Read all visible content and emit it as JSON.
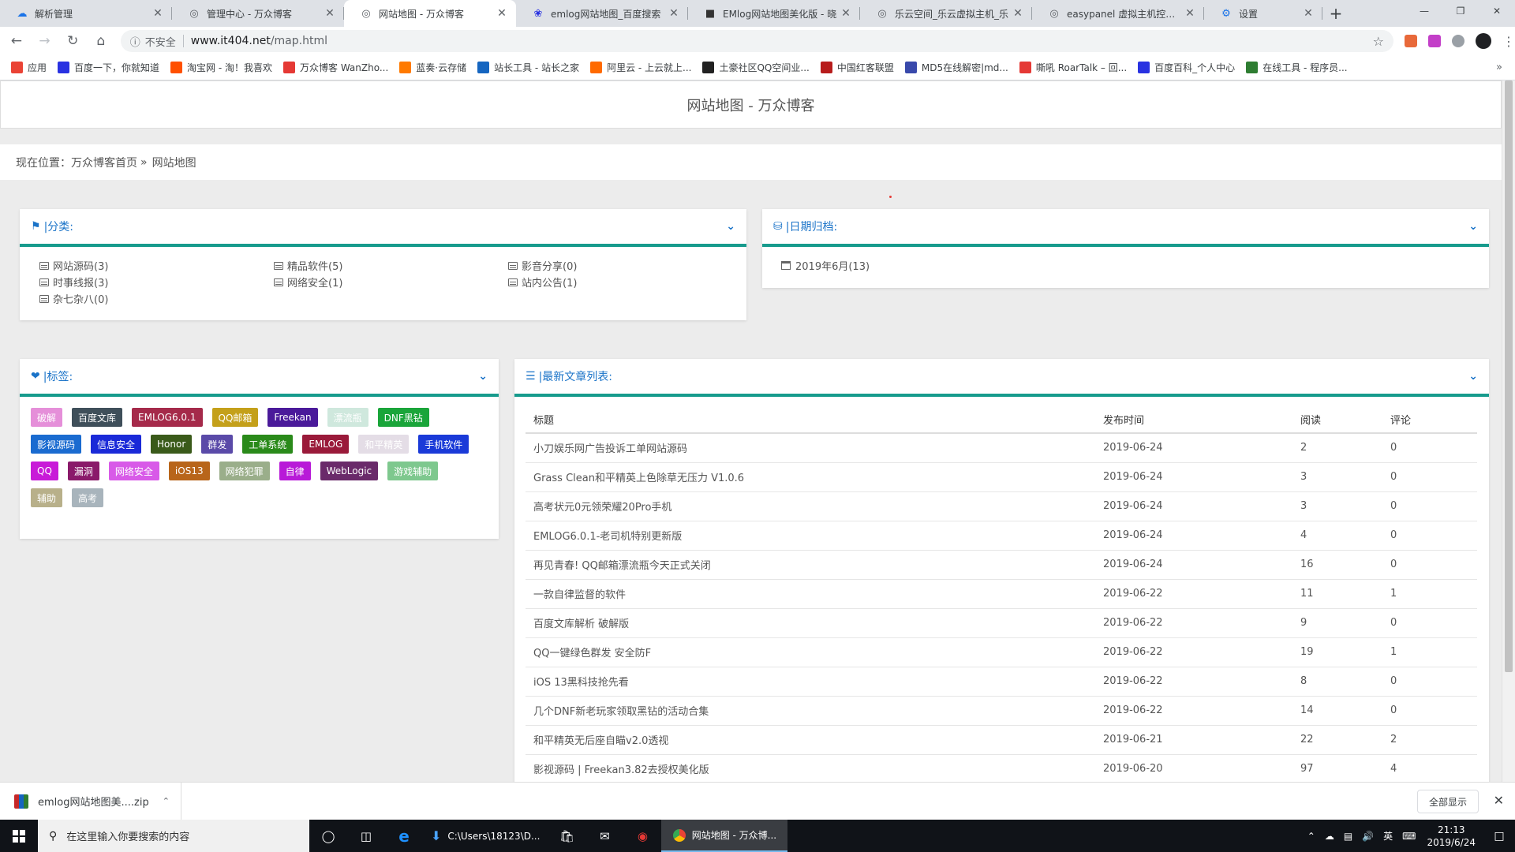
{
  "tabs": [
    {
      "title": "解析管理",
      "icon": "cloud-icon",
      "color": "#1a73e8"
    },
    {
      "title": "管理中心 - 万众博客",
      "icon": "globe-icon",
      "color": "#5f6368"
    },
    {
      "title": "网站地图 - 万众博客",
      "icon": "globe-icon",
      "color": "#5f6368",
      "active": true
    },
    {
      "title": "emlog网站地图_百度搜索",
      "icon": "baidu-paw-icon",
      "color": "#2932e1"
    },
    {
      "title": "EMlog网站地图美化版 - 晓",
      "icon": "site-icon",
      "color": "#333333"
    },
    {
      "title": "乐云空间_乐云虚拟主机_乐",
      "icon": "globe-icon",
      "color": "#5f6368"
    },
    {
      "title": "easypanel 虚拟主机控制面",
      "icon": "globe-icon",
      "color": "#5f6368"
    },
    {
      "title": "设置",
      "icon": "gear-icon",
      "color": "#1a73e8"
    }
  ],
  "addressbar": {
    "security": "不安全",
    "url_host": "www.it404.net",
    "url_path": "/map.html"
  },
  "bookmarks": [
    {
      "label": "应用",
      "color": "#ea4335"
    },
    {
      "label": "百度一下，你就知道",
      "color": "#2932e1"
    },
    {
      "label": "淘宝网 - 淘！我喜欢",
      "color": "#ff5000"
    },
    {
      "label": "万众博客 WanZho...",
      "color": "#e53935"
    },
    {
      "label": "蓝奏·云存储",
      "color": "#ff7a00"
    },
    {
      "label": "站长工具 - 站长之家",
      "color": "#1565c0"
    },
    {
      "label": "阿里云 - 上云就上...",
      "color": "#ff6a00"
    },
    {
      "label": "土豪社区QQ空间业...",
      "color": "#222222"
    },
    {
      "label": "中国红客联盟",
      "color": "#b71c1c"
    },
    {
      "label": "MD5在线解密|md...",
      "color": "#3949ab"
    },
    {
      "label": "嘶吼 RoarTalk – 回...",
      "color": "#e53935"
    },
    {
      "label": "百度百科_个人中心",
      "color": "#2932e1"
    },
    {
      "label": "在线工具 - 程序员...",
      "color": "#2e7d32"
    }
  ],
  "page": {
    "site_title": "网站地图 - 万众博客",
    "breadcrumb_prefix": "现在位置：",
    "breadcrumb_home": "万众博客首页",
    "breadcrumb_sep": "»",
    "breadcrumb_current": "网站地图"
  },
  "categories": {
    "title": "|分类:",
    "items": [
      "网站源码(3)",
      "精品软件(5)",
      "影音分享(0)",
      "时事线报(3)",
      "网络安全(1)",
      "站内公告(1)",
      "杂七杂八(0)"
    ]
  },
  "archive": {
    "title": "|日期归档:",
    "items": [
      "2019年6月(13)"
    ]
  },
  "tags": {
    "title": "|标签:",
    "items": [
      {
        "label": "破解",
        "color": "#e58fd9"
      },
      {
        "label": "百度文库",
        "color": "#3f4f5a"
      },
      {
        "label": "EMLOG6.0.1",
        "color": "#a52a4a"
      },
      {
        "label": "QQ邮箱",
        "color": "#c4a01a"
      },
      {
        "label": "Freekan",
        "color": "#4a1a9a"
      },
      {
        "label": "漂流瓶",
        "color": "#cfe8dd"
      },
      {
        "label": "DNF黑钻",
        "color": "#1aa53a"
      },
      {
        "label": "影视源码",
        "color": "#1a6bd0"
      },
      {
        "label": "信息安全",
        "color": "#1a2ad8"
      },
      {
        "label": "Honor",
        "color": "#3a5a1a"
      },
      {
        "label": "群发",
        "color": "#5a4aa8"
      },
      {
        "label": "工单系统",
        "color": "#2a8a1a"
      },
      {
        "label": "EMLOG",
        "color": "#9a1a3a"
      },
      {
        "label": "和平精英",
        "color": "#e4dde6"
      },
      {
        "label": "手机软件",
        "color": "#1a3ad8"
      },
      {
        "label": "QQ",
        "color": "#c81ad8"
      },
      {
        "label": "漏洞",
        "color": "#8a1a6a"
      },
      {
        "label": "网络安全",
        "color": "#d85ae8"
      },
      {
        "label": "iOS13",
        "color": "#b8651a"
      },
      {
        "label": "网络犯罪",
        "color": "#9aae8a"
      },
      {
        "label": "自律",
        "color": "#b81ad8"
      },
      {
        "label": "WebLogic",
        "color": "#6a2a6a"
      },
      {
        "label": "游戏辅助",
        "color": "#7ec88e"
      },
      {
        "label": "辅助",
        "color": "#b8b08a"
      },
      {
        "label": "高考",
        "color": "#a8b4bc"
      }
    ]
  },
  "posts": {
    "title": "|最新文章列表:",
    "headers": [
      "标题",
      "发布时间",
      "阅读",
      "评论"
    ],
    "rows": [
      [
        "小刀娱乐网广告投诉工单网站源码",
        "2019-06-24",
        "2",
        "0"
      ],
      [
        "Grass Clean和平精英上色除草无压力 V1.0.6",
        "2019-06-24",
        "3",
        "0"
      ],
      [
        "高考状元0元领荣耀20Pro手机",
        "2019-06-24",
        "3",
        "0"
      ],
      [
        "EMLOG6.0.1-老司机特别更新版",
        "2019-06-24",
        "4",
        "0"
      ],
      [
        "再见青春! QQ邮箱漂流瓶今天正式关闭",
        "2019-06-24",
        "16",
        "0"
      ],
      [
        "一款自律监督的软件",
        "2019-06-22",
        "11",
        "1"
      ],
      [
        "百度文库解析 破解版",
        "2019-06-22",
        "9",
        "0"
      ],
      [
        "QQ一键绿色群发 安全防F",
        "2019-06-22",
        "19",
        "1"
      ],
      [
        "iOS 13黑科技抢先看",
        "2019-06-22",
        "8",
        "0"
      ],
      [
        "几个DNF新老玩家领取黑钻的活动合集",
        "2019-06-22",
        "14",
        "0"
      ],
      [
        "和平精英无后座自瞄v2.0透视",
        "2019-06-21",
        "22",
        "2"
      ],
      [
        "影视源码 | Freekan3.82去授权美化版",
        "2019-06-20",
        "97",
        "4"
      ]
    ]
  },
  "download": {
    "filename": "emlog网站地图美....zip",
    "show_all": "全部显示"
  },
  "taskbar": {
    "search_placeholder": "在这里输入你要搜索的内容",
    "explorer_label": "C:\\Users\\18123\\D...",
    "chrome_label": "网站地图 - 万众博...",
    "ime": "英",
    "time": "21:13",
    "date": "2019/6/24"
  }
}
